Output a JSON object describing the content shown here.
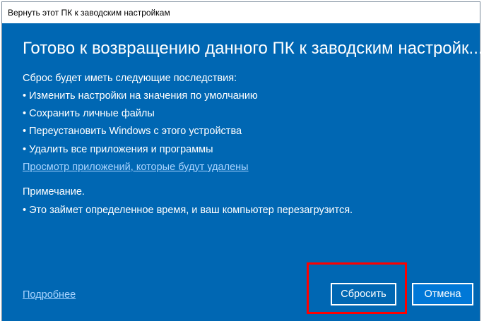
{
  "window": {
    "title": "Вернуть этот ПК к заводским настройкам"
  },
  "main": {
    "heading": "Готово к возвращению данного ПК к заводским настройк...",
    "intro": "Сброс будет иметь следующие последствия:",
    "effects": [
      "• Изменить настройки на значения по умолчанию",
      "• Сохранить личные файлы",
      "• Переустановить Windows с этого устройства",
      "• Удалить все приложения и программы"
    ],
    "apps_link": "Просмотр приложений, которые будут удалены",
    "note_label": "Примечание.",
    "note_item": "•  Это займет определенное время, и ваш компьютер перезагрузится."
  },
  "footer": {
    "more_link": "Подробнее",
    "reset_label": "Сбросить",
    "cancel_label": "Отмена"
  },
  "colors": {
    "background": "#0067b3",
    "highlight": "#ff0000"
  }
}
